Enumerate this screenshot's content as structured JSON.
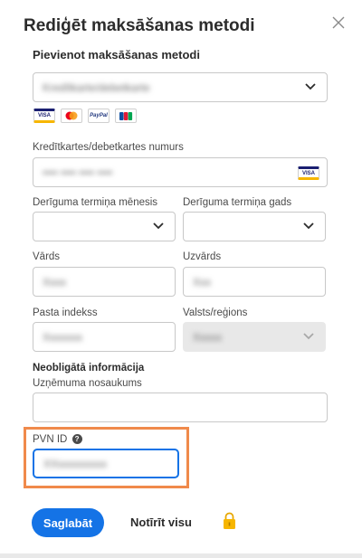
{
  "dialog": {
    "title": "Rediģēt maksāšanas metodi",
    "section_title": "Pievienot maksāšanas metodi"
  },
  "payment_method_select": {
    "value": "Kredītkarte/debetkarte"
  },
  "card_icons": [
    "VISA",
    "MC",
    "PayPal",
    "JCB"
  ],
  "card_number": {
    "label": "Kredītkartes/debetkartes numurs",
    "value": "•••• •••• •••• ••••",
    "badge": "VISA"
  },
  "expiry_month": {
    "label": "Derīguma termiņa mēnesis",
    "value": ""
  },
  "expiry_year": {
    "label": "Derīguma termiņa gads",
    "value": ""
  },
  "first_name": {
    "label": "Vārds",
    "value": "Xxxx"
  },
  "last_name": {
    "label": "Uzvārds",
    "value": "Xxx"
  },
  "postal_code": {
    "label": "Pasta indekss",
    "value": "Xxxxxxx"
  },
  "country": {
    "label": "Valsts/reģions",
    "value": "Xxxxx"
  },
  "optional": {
    "heading": "Neobligātā informācija",
    "company_label": "Uzņēmuma nosaukums",
    "company_value": ""
  },
  "vat": {
    "label": "PVN ID",
    "help": "?",
    "value": "XXxxxxxxxxx"
  },
  "buttons": {
    "save": "Saglabāt",
    "clear": "Notīrīt visu"
  },
  "colors": {
    "accent": "#1473e6",
    "highlight": "#f08a4b"
  }
}
